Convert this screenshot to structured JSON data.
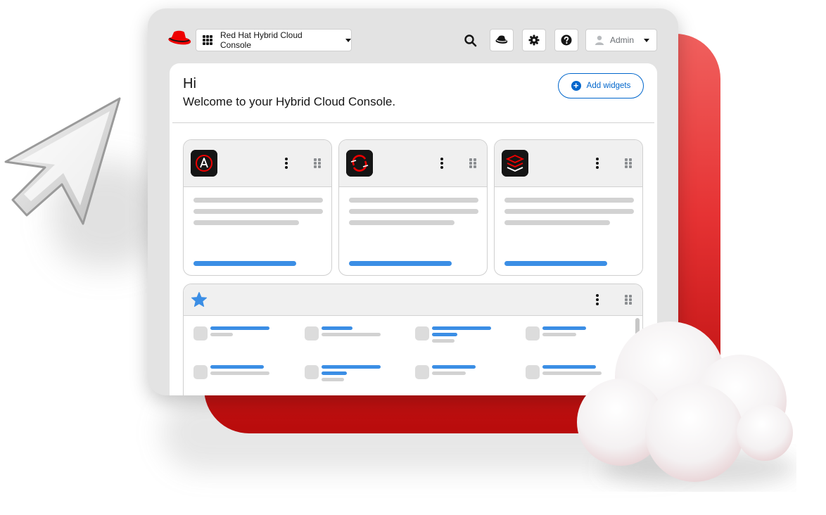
{
  "header": {
    "app_switcher_label": "Red Hat Hybrid Cloud Console",
    "user_label": "Admin"
  },
  "main": {
    "greeting": "Hi",
    "welcome": "Welcome to your Hybrid Cloud Console.",
    "add_widgets_label": "Add widgets"
  },
  "widgets": [
    {
      "icon": "ansible-icon"
    },
    {
      "icon": "openshift-icon"
    },
    {
      "icon": "rhel-stack-icon"
    }
  ],
  "favorites": {
    "icon": "star-icon"
  },
  "colors": {
    "brand_red": "#ee0000",
    "accent_blue": "#0066cc",
    "skeleton_gray": "#d2d2d2"
  }
}
